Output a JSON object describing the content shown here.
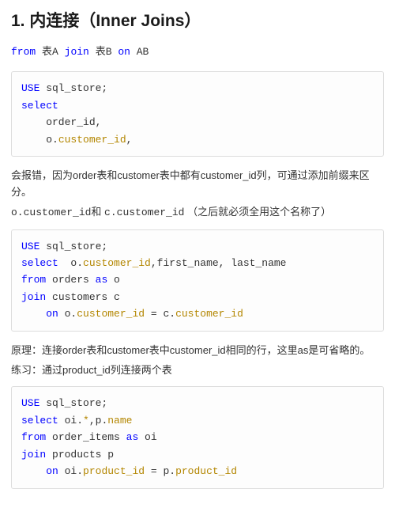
{
  "heading": "1. 内连接（Inner Joins）",
  "syntax": {
    "from": "from",
    "tabA": "表A",
    "join": "join",
    "tabB": "表B",
    "on": "on",
    "ab": "AB"
  },
  "code1": {
    "l1_kw": "USE",
    "l1_rest": " sql_store;",
    "l2_kw": "select",
    "l3": "    order_id,",
    "l4_pre": "    o.",
    "l4_col": "customer_id",
    "l4_post": ","
  },
  "para1_a": "会报错，因为order表和customer表中都有customer_id列，可通过添加前缀来区分。",
  "para1_b_pre": "o.customer_id",
  "para1_b_mid": "和 ",
  "para1_b_cc": "c.customer_id",
  "para1_b_post": " （之后就必须全用这个名称了）",
  "code2": {
    "l1_kw": "USE",
    "l1_rest": " sql_store;",
    "l2_kw": "select",
    "l2_mid1": "  o.",
    "l2_col": "customer_id",
    "l2_rest": ",first_name, last_name",
    "l3_kw": "from",
    "l3_mid": " orders ",
    "l3_as": "as",
    "l3_rest": " o",
    "l4_kw": "join",
    "l4_rest": " customers c",
    "l5_pre": "    ",
    "l5_on": "on",
    "l5_mid1": " o.",
    "l5_c1": "customer_id",
    "l5_eq": " = ",
    "l5_mid2": "c.",
    "l5_c2": "customer_id"
  },
  "para2": "原理：连接order表和customer表中customer_id相同的行，这里as是可省略的。",
  "para3": "练习：通过product_id列连接两个表",
  "code3": {
    "l1_kw": "USE",
    "l1_rest": " sql_store;",
    "l2_kw": "select",
    "l2_m1": " oi.",
    "l2_star": "*",
    "l2_m2": ",p.",
    "l2_name": "name",
    "l3_kw": "from",
    "l3_mid": " order_items ",
    "l3_as": "as",
    "l3_rest": " oi",
    "l4_kw": "join",
    "l4_rest": " products p",
    "l5_pre": "    ",
    "l5_on": "on",
    "l5_m1": " oi.",
    "l5_c1": "product_id",
    "l5_eq": " = ",
    "l5_m2": "p.",
    "l5_c2": "product_id"
  }
}
